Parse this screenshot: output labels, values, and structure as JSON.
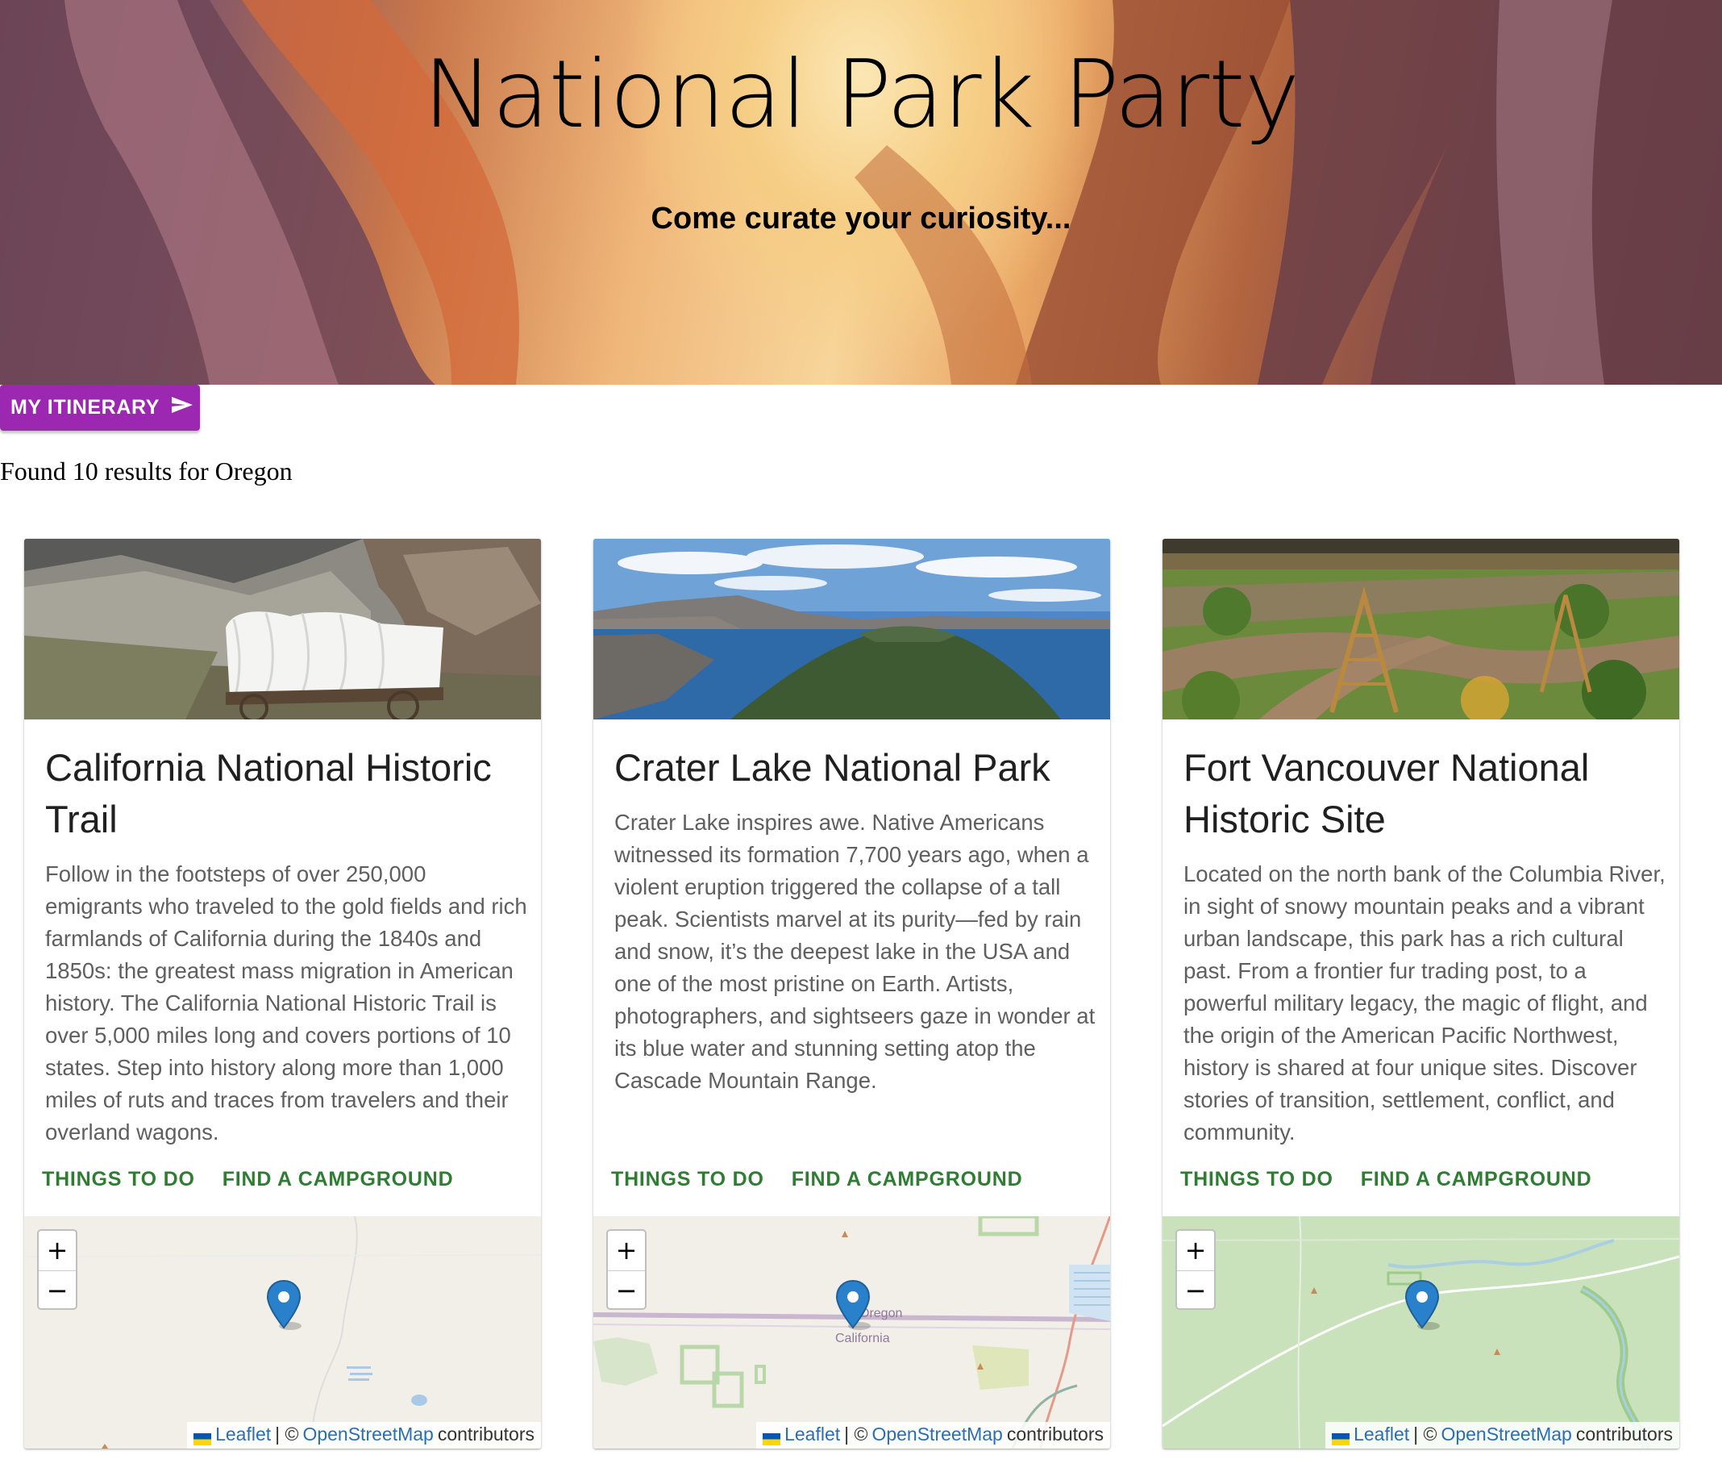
{
  "hero": {
    "title": "National Park Party",
    "subtitle": "Come curate your curiosity..."
  },
  "itinerary_button": {
    "label": "MY ITINERARY",
    "icon": "send-icon"
  },
  "results_text": "Found 10 results for Oregon",
  "colors": {
    "button_purple": "#9c27b0",
    "action_green": "#2e7d32",
    "link_blue": "#2a6fb3",
    "marker_blue": "#2a81cb"
  },
  "cards": [
    {
      "title": "California National Historic Trail",
      "description": "Follow in the footsteps of over 250,000 emigrants who traveled to the gold fields and rich farmlands of California during the 1840s and 1850s: the greatest mass migration in American history. The California National Historic Trail is over 5,000 miles long and covers portions of 10 states. Step into history along more than 1,000 miles of ruts and traces from travelers and their overland wagons.",
      "actions": [
        "THINGS TO DO",
        "FIND A CAMPGROUND"
      ],
      "photo": "covered-wagon-photo",
      "map": {
        "zoom_in": "+",
        "zoom_out": "−",
        "labels": []
      }
    },
    {
      "title": "Crater Lake National Park",
      "description": "Crater Lake inspires awe. Native Americans witnessed its formation 7,700 years ago, when a violent eruption triggered the collapse of a tall peak. Scientists marvel at its purity—fed by rain and snow, it’s the deepest lake in the USA and one of the most pristine on Earth. Artists, photographers, and sightseers gaze in wonder at its blue water and stunning setting atop the Cascade Mountain Range.",
      "actions": [
        "THINGS TO DO",
        "FIND A CAMPGROUND"
      ],
      "photo": "crater-lake-photo",
      "map": {
        "zoom_in": "+",
        "zoom_out": "−",
        "labels": [
          "Oregon",
          "California"
        ]
      }
    },
    {
      "title": "Fort Vancouver National Historic Site",
      "description": "Located on the north bank of the Columbia River, in sight of snowy mountain peaks and a vibrant urban landscape, this park has a rich cultural past. From a frontier fur trading post, to a powerful military legacy, the magic of flight, and the origin of the American Pacific Northwest, history is shared at four unique sites. Discover stories of transition, settlement, conflict, and community.",
      "actions": [
        "THINGS TO DO",
        "FIND A CAMPGROUND"
      ],
      "photo": "garden-photo",
      "map": {
        "zoom_in": "+",
        "zoom_out": "−",
        "labels": []
      }
    }
  ],
  "attribution": {
    "leaflet": "Leaflet",
    "separator": "| ©",
    "osm": "OpenStreetMap",
    "contributors": "contributors"
  }
}
